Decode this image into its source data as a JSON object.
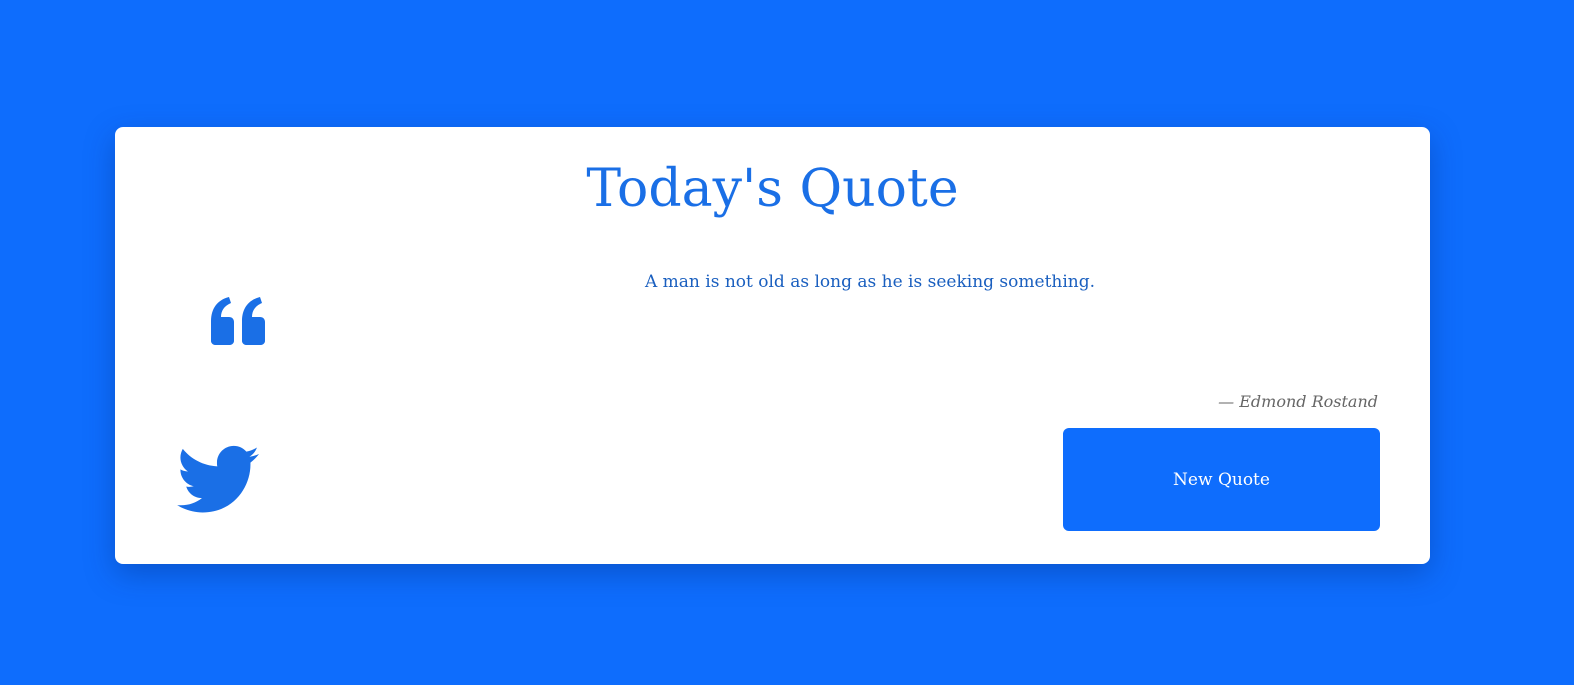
{
  "card": {
    "title": "Today's Quote",
    "quote": "A man is not old as long as he is seeking something.",
    "author": "— Edmond Rostand",
    "new_quote_label": "New Quote"
  },
  "icons": {
    "quote": "quote-left-icon",
    "twitter": "twitter-icon"
  },
  "colors": {
    "background": "#0e6dfd",
    "accent": "#1a6fe6",
    "card": "#ffffff",
    "author": "#666666"
  }
}
